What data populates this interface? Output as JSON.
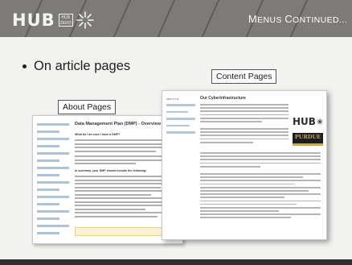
{
  "header": {
    "logo_text": "HUB",
    "logo_box_text": "HUB ZERO",
    "title_first": "M",
    "title_rest": "ENUS ",
    "title_second": "C",
    "title_rest2": "ONTINUED..."
  },
  "bullet": "On article pages",
  "labels": {
    "about": "About Pages",
    "content": "Content Pages"
  },
  "about_page": {
    "title": "Data Management Plan (DMP) - Overview",
    "subhead_1": "What do I do once I have a DMP?",
    "subhead_2": "In summary, your DMP should include the following:"
  },
  "content_page": {
    "sidebar_heading": "ABOUT US",
    "title": "Our Cyberinfrastructure",
    "purdue_logo": "PURDUE"
  },
  "colors": {
    "header_bg": "#7d7b78",
    "link_blue": "#6d8fb5",
    "purdue_gold": "#c9a65a"
  }
}
